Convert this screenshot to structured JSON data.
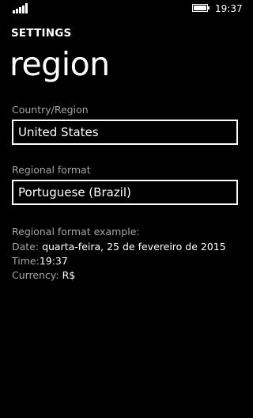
{
  "status_bar": {
    "time": "19:37"
  },
  "header": {
    "settings": "SETTINGS",
    "title": "region"
  },
  "country": {
    "label": "Country/Region",
    "value": "United States"
  },
  "format": {
    "label": "Regional format",
    "value": "Portuguese (Brazil)"
  },
  "example": {
    "heading": "Regional format example:",
    "date_label": "Date:",
    "date_value": " quarta-feira, 25 de fevereiro de 2015",
    "time_label": "Time:",
    "time_value": "19:37",
    "currency_label": "Currency:",
    "currency_value": " R$"
  },
  "colors": {
    "background": "#000000",
    "text": "#ffffff",
    "label": "#a5a5a5"
  }
}
